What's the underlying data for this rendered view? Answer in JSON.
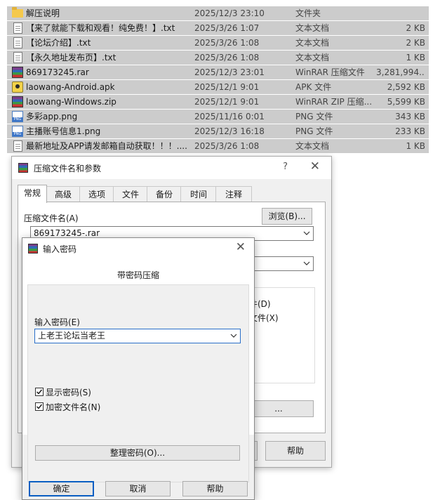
{
  "files": [
    {
      "name": "解压说明",
      "date": "2025/12/3 23:10",
      "type": "文件夹",
      "size": "",
      "icon": "folder-icon"
    },
    {
      "name": "【来了就能下载和观看！纯免费！】.txt",
      "date": "2025/3/26 1:07",
      "type": "文本文档",
      "size": "2 KB",
      "icon": "text-file-icon"
    },
    {
      "name": "【论坛介绍】.txt",
      "date": "2025/3/26 1:08",
      "type": "文本文档",
      "size": "2 KB",
      "icon": "text-file-icon"
    },
    {
      "name": "【永久地址发布页】.txt",
      "date": "2025/3/26 1:08",
      "type": "文本文档",
      "size": "1 KB",
      "icon": "text-file-icon"
    },
    {
      "name": "869173245.rar",
      "date": "2025/12/3 23:01",
      "type": "WinRAR 压缩文件",
      "size": "3,281,994...",
      "icon": "rar-archive-icon"
    },
    {
      "name": "laowang-Android.apk",
      "date": "2025/12/1 9:01",
      "type": "APK 文件",
      "size": "2,592 KB",
      "icon": "apk-file-icon"
    },
    {
      "name": "laowang-Windows.zip",
      "date": "2025/12/1 9:01",
      "type": "WinRAR ZIP 压缩...",
      "size": "5,599 KB",
      "icon": "zip-archive-icon"
    },
    {
      "name": "多彩app.png",
      "date": "2025/11/16 0:01",
      "type": "PNG 文件",
      "size": "343 KB",
      "icon": "png-file-icon"
    },
    {
      "name": "主播账号信息1.png",
      "date": "2025/12/3 16:18",
      "type": "PNG 文件",
      "size": "233 KB",
      "icon": "png-file-icon"
    },
    {
      "name": "最新地址及APP请发邮箱自动获取！！！....",
      "date": "2025/3/26 1:08",
      "type": "文本文档",
      "size": "1 KB",
      "icon": "text-file-icon"
    }
  ],
  "archive_dialog": {
    "title": "压缩文件名和参数",
    "help": "?",
    "close": "✕",
    "tabs": [
      "常规",
      "高级",
      "选项",
      "文件",
      "备份",
      "时间",
      "注释"
    ],
    "active_tab": "常规",
    "archive_name_label": "压缩文件名(A)",
    "archive_name_value": "869173245-.rar",
    "browse_button": "浏览(B)...",
    "partial_option_1": "件(D)",
    "partial_option_2": "文件(X)",
    "partial_button": "...",
    "help_button": "帮助"
  },
  "password_dialog": {
    "title": "输入密码",
    "close": "✕",
    "caption": "带密码压缩",
    "password_label": "输入密码(E)",
    "password_value": "上老王论坛当老王",
    "show_password_label": "显示密码(S)",
    "show_password_checked": true,
    "encrypt_names_label": "加密文件名(N)",
    "encrypt_names_checked": true,
    "manage_button": "整理密码(O)...",
    "ok_button": "确定",
    "cancel_button": "取消",
    "help_button": "帮助"
  },
  "colors": {
    "row_selected": "#cccccc",
    "focus_blue": "#0a5ec2"
  }
}
